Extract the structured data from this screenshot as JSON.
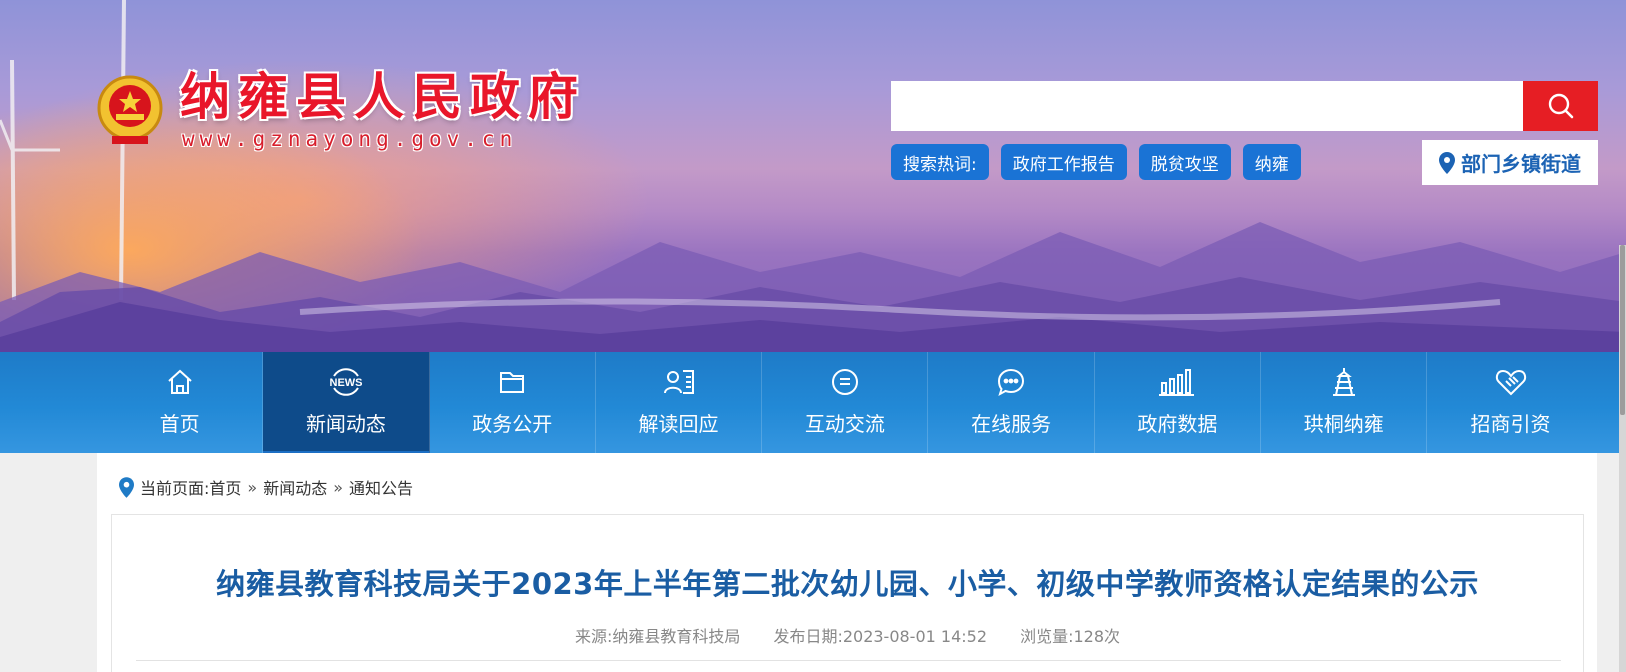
{
  "header": {
    "site_title": "纳雍县人民政府",
    "site_url": "www.gznayong.gov.cn",
    "search": {
      "placeholder": ""
    },
    "hot_search_label": "搜索热词:",
    "hot_search_terms": [
      "政府工作报告",
      "脱贫攻坚",
      "纳雍"
    ],
    "dept_link": "部门乡镇街道"
  },
  "nav": {
    "items": [
      {
        "label": "首页",
        "icon": "home-icon"
      },
      {
        "label": "新闻动态",
        "icon": "news-icon",
        "badge": "NEWS",
        "active": true
      },
      {
        "label": "政务公开",
        "icon": "folder-icon"
      },
      {
        "label": "解读回应",
        "icon": "interpretation-icon"
      },
      {
        "label": "互动交流",
        "icon": "chat-icon"
      },
      {
        "label": "在线服务",
        "icon": "message-icon"
      },
      {
        "label": "政府数据",
        "icon": "bar-chart-icon"
      },
      {
        "label": "珙桐纳雍",
        "icon": "tower-icon"
      },
      {
        "label": "招商引资",
        "icon": "handshake-icon"
      }
    ]
  },
  "breadcrumb": {
    "prefix": "当前页面:",
    "items": [
      "首页",
      "新闻动态",
      "通知公告"
    ],
    "separator": "»"
  },
  "article": {
    "title": "纳雍县教育科技局关于2023年上半年第二批次幼儿园、小学、初级中学教师资格认定结果的公示",
    "source": "来源:纳雍县教育科技局",
    "date": "发布日期:2023-08-01 14:52",
    "views": "浏览量:128次"
  },
  "colors": {
    "nav_blue": "#2289d6",
    "nav_active": "#0e4b8a",
    "title_red": "#e9162a",
    "search_red": "#e61e24",
    "tag_blue": "#1a73d5",
    "article_title": "#1a5da3"
  }
}
